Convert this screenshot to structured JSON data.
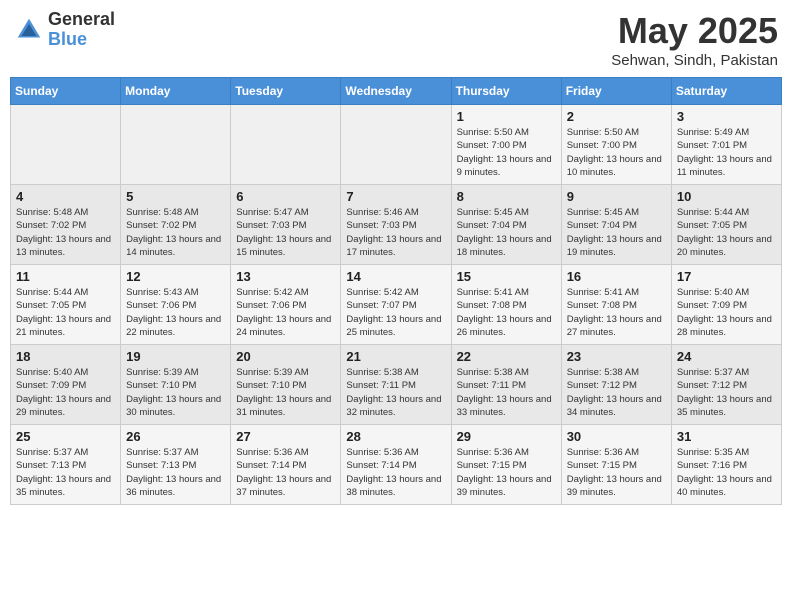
{
  "header": {
    "logo_general": "General",
    "logo_blue": "Blue",
    "month_year": "May 2025",
    "location": "Sehwan, Sindh, Pakistan"
  },
  "days_of_week": [
    "Sunday",
    "Monday",
    "Tuesday",
    "Wednesday",
    "Thursday",
    "Friday",
    "Saturday"
  ],
  "weeks": [
    [
      {
        "day": "",
        "sunrise": "",
        "sunset": "",
        "daylight": ""
      },
      {
        "day": "",
        "sunrise": "",
        "sunset": "",
        "daylight": ""
      },
      {
        "day": "",
        "sunrise": "",
        "sunset": "",
        "daylight": ""
      },
      {
        "day": "",
        "sunrise": "",
        "sunset": "",
        "daylight": ""
      },
      {
        "day": "1",
        "sunrise": "Sunrise: 5:50 AM",
        "sunset": "Sunset: 7:00 PM",
        "daylight": "Daylight: 13 hours and 9 minutes."
      },
      {
        "day": "2",
        "sunrise": "Sunrise: 5:50 AM",
        "sunset": "Sunset: 7:00 PM",
        "daylight": "Daylight: 13 hours and 10 minutes."
      },
      {
        "day": "3",
        "sunrise": "Sunrise: 5:49 AM",
        "sunset": "Sunset: 7:01 PM",
        "daylight": "Daylight: 13 hours and 11 minutes."
      }
    ],
    [
      {
        "day": "4",
        "sunrise": "Sunrise: 5:48 AM",
        "sunset": "Sunset: 7:02 PM",
        "daylight": "Daylight: 13 hours and 13 minutes."
      },
      {
        "day": "5",
        "sunrise": "Sunrise: 5:48 AM",
        "sunset": "Sunset: 7:02 PM",
        "daylight": "Daylight: 13 hours and 14 minutes."
      },
      {
        "day": "6",
        "sunrise": "Sunrise: 5:47 AM",
        "sunset": "Sunset: 7:03 PM",
        "daylight": "Daylight: 13 hours and 15 minutes."
      },
      {
        "day": "7",
        "sunrise": "Sunrise: 5:46 AM",
        "sunset": "Sunset: 7:03 PM",
        "daylight": "Daylight: 13 hours and 17 minutes."
      },
      {
        "day": "8",
        "sunrise": "Sunrise: 5:45 AM",
        "sunset": "Sunset: 7:04 PM",
        "daylight": "Daylight: 13 hours and 18 minutes."
      },
      {
        "day": "9",
        "sunrise": "Sunrise: 5:45 AM",
        "sunset": "Sunset: 7:04 PM",
        "daylight": "Daylight: 13 hours and 19 minutes."
      },
      {
        "day": "10",
        "sunrise": "Sunrise: 5:44 AM",
        "sunset": "Sunset: 7:05 PM",
        "daylight": "Daylight: 13 hours and 20 minutes."
      }
    ],
    [
      {
        "day": "11",
        "sunrise": "Sunrise: 5:44 AM",
        "sunset": "Sunset: 7:05 PM",
        "daylight": "Daylight: 13 hours and 21 minutes."
      },
      {
        "day": "12",
        "sunrise": "Sunrise: 5:43 AM",
        "sunset": "Sunset: 7:06 PM",
        "daylight": "Daylight: 13 hours and 22 minutes."
      },
      {
        "day": "13",
        "sunrise": "Sunrise: 5:42 AM",
        "sunset": "Sunset: 7:06 PM",
        "daylight": "Daylight: 13 hours and 24 minutes."
      },
      {
        "day": "14",
        "sunrise": "Sunrise: 5:42 AM",
        "sunset": "Sunset: 7:07 PM",
        "daylight": "Daylight: 13 hours and 25 minutes."
      },
      {
        "day": "15",
        "sunrise": "Sunrise: 5:41 AM",
        "sunset": "Sunset: 7:08 PM",
        "daylight": "Daylight: 13 hours and 26 minutes."
      },
      {
        "day": "16",
        "sunrise": "Sunrise: 5:41 AM",
        "sunset": "Sunset: 7:08 PM",
        "daylight": "Daylight: 13 hours and 27 minutes."
      },
      {
        "day": "17",
        "sunrise": "Sunrise: 5:40 AM",
        "sunset": "Sunset: 7:09 PM",
        "daylight": "Daylight: 13 hours and 28 minutes."
      }
    ],
    [
      {
        "day": "18",
        "sunrise": "Sunrise: 5:40 AM",
        "sunset": "Sunset: 7:09 PM",
        "daylight": "Daylight: 13 hours and 29 minutes."
      },
      {
        "day": "19",
        "sunrise": "Sunrise: 5:39 AM",
        "sunset": "Sunset: 7:10 PM",
        "daylight": "Daylight: 13 hours and 30 minutes."
      },
      {
        "day": "20",
        "sunrise": "Sunrise: 5:39 AM",
        "sunset": "Sunset: 7:10 PM",
        "daylight": "Daylight: 13 hours and 31 minutes."
      },
      {
        "day": "21",
        "sunrise": "Sunrise: 5:38 AM",
        "sunset": "Sunset: 7:11 PM",
        "daylight": "Daylight: 13 hours and 32 minutes."
      },
      {
        "day": "22",
        "sunrise": "Sunrise: 5:38 AM",
        "sunset": "Sunset: 7:11 PM",
        "daylight": "Daylight: 13 hours and 33 minutes."
      },
      {
        "day": "23",
        "sunrise": "Sunrise: 5:38 AM",
        "sunset": "Sunset: 7:12 PM",
        "daylight": "Daylight: 13 hours and 34 minutes."
      },
      {
        "day": "24",
        "sunrise": "Sunrise: 5:37 AM",
        "sunset": "Sunset: 7:12 PM",
        "daylight": "Daylight: 13 hours and 35 minutes."
      }
    ],
    [
      {
        "day": "25",
        "sunrise": "Sunrise: 5:37 AM",
        "sunset": "Sunset: 7:13 PM",
        "daylight": "Daylight: 13 hours and 35 minutes."
      },
      {
        "day": "26",
        "sunrise": "Sunrise: 5:37 AM",
        "sunset": "Sunset: 7:13 PM",
        "daylight": "Daylight: 13 hours and 36 minutes."
      },
      {
        "day": "27",
        "sunrise": "Sunrise: 5:36 AM",
        "sunset": "Sunset: 7:14 PM",
        "daylight": "Daylight: 13 hours and 37 minutes."
      },
      {
        "day": "28",
        "sunrise": "Sunrise: 5:36 AM",
        "sunset": "Sunset: 7:14 PM",
        "daylight": "Daylight: 13 hours and 38 minutes."
      },
      {
        "day": "29",
        "sunrise": "Sunrise: 5:36 AM",
        "sunset": "Sunset: 7:15 PM",
        "daylight": "Daylight: 13 hours and 39 minutes."
      },
      {
        "day": "30",
        "sunrise": "Sunrise: 5:36 AM",
        "sunset": "Sunset: 7:15 PM",
        "daylight": "Daylight: 13 hours and 39 minutes."
      },
      {
        "day": "31",
        "sunrise": "Sunrise: 5:35 AM",
        "sunset": "Sunset: 7:16 PM",
        "daylight": "Daylight: 13 hours and 40 minutes."
      }
    ]
  ]
}
